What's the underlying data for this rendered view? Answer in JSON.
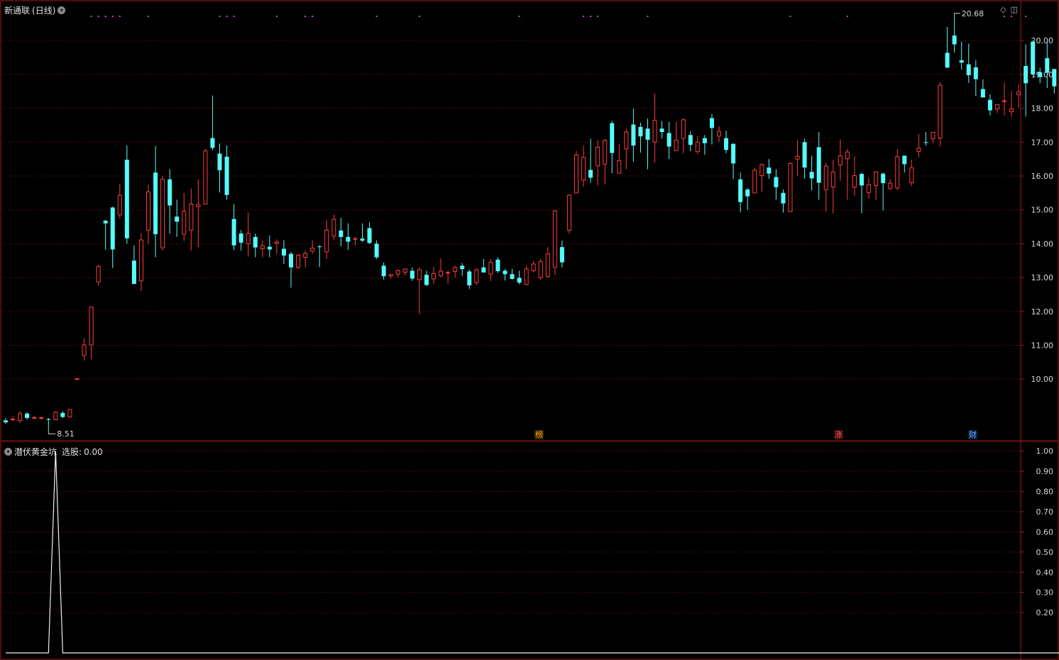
{
  "stock": {
    "name": "新通联",
    "period": "(日线)"
  },
  "indicator": {
    "name": "潜伏黄金坑",
    "label": "选股:",
    "value": "0.00"
  },
  "colors": {
    "up": "#ff3c3c",
    "down": "#54fcfc",
    "grid": "#7a1a1a",
    "frame": "#a01818",
    "signal": "#e040e0"
  },
  "price_axis": {
    "ticks": [
      "20.00",
      "19.00",
      "18.00",
      "17.00",
      "16.00",
      "15.00",
      "14.00",
      "13.00",
      "12.00",
      "11.00",
      "10.00"
    ]
  },
  "indicator_axis": {
    "ticks": [
      "1.00",
      "0.90",
      "0.80",
      "0.70",
      "0.60",
      "0.50",
      "0.40",
      "0.30",
      "0.20"
    ]
  },
  "annotations": {
    "high": "20.68",
    "low": "8.51"
  },
  "markers": [
    {
      "label": "榜",
      "color": "#e8a020"
    },
    {
      "label": "涨",
      "color": "#ff6060"
    },
    {
      "label": "财",
      "color": "#6aa8ff"
    }
  ],
  "chart_data": {
    "type": "candlestick",
    "ylim": [
      8.2,
      21.2
    ],
    "candles": [
      [
        8.78,
        8.72,
        8.85,
        8.68
      ],
      [
        8.8,
        8.82,
        8.9,
        8.75
      ],
      [
        8.78,
        8.98,
        9.05,
        8.7
      ],
      [
        8.98,
        8.85,
        9.02,
        8.8
      ],
      [
        8.85,
        8.86,
        8.92,
        8.82
      ],
      [
        8.84,
        8.86,
        8.9,
        8.8
      ],
      [
        8.82,
        8.8,
        8.85,
        8.51
      ],
      [
        8.8,
        9.02,
        9.05,
        8.78
      ],
      [
        9.0,
        8.88,
        9.05,
        8.85
      ],
      [
        8.88,
        9.1,
        9.12,
        8.86
      ],
      [
        10.01,
        10.01,
        10.02,
        10.0
      ],
      [
        10.7,
        11.01,
        11.2,
        10.55
      ],
      [
        11.01,
        12.13,
        12.14,
        10.58
      ],
      [
        12.87,
        13.33,
        13.37,
        12.76
      ],
      [
        14.68,
        14.6,
        14.7,
        13.82
      ],
      [
        15.07,
        13.83,
        15.09,
        13.28
      ],
      [
        14.85,
        15.43,
        15.76,
        14.75
      ],
      [
        16.48,
        14.16,
        16.9,
        14.0
      ],
      [
        13.5,
        12.81,
        13.95,
        12.8
      ],
      [
        12.9,
        14.11,
        14.31,
        12.6
      ],
      [
        14.4,
        15.53,
        15.74,
        14.0
      ],
      [
        16.1,
        14.28,
        16.89,
        13.6
      ],
      [
        13.88,
        15.9,
        16.0,
        13.8
      ],
      [
        15.9,
        15.13,
        16.2,
        14.3
      ],
      [
        14.8,
        14.65,
        15.3,
        14.2
      ],
      [
        14.28,
        14.96,
        15.5,
        14.08
      ],
      [
        14.4,
        15.17,
        15.63,
        13.8
      ],
      [
        15.1,
        15.16,
        15.9,
        13.9
      ],
      [
        15.17,
        16.74,
        16.8,
        15.3
      ],
      [
        17.12,
        16.83,
        18.38,
        16.76
      ],
      [
        16.66,
        16.17,
        16.96,
        15.51
      ],
      [
        16.57,
        15.44,
        16.9,
        15.3
      ],
      [
        14.73,
        13.95,
        15.17,
        13.81
      ],
      [
        14.3,
        14.03,
        14.4,
        13.8
      ],
      [
        14.0,
        14.3,
        14.92,
        13.62
      ],
      [
        14.2,
        13.89,
        14.3,
        13.6
      ],
      [
        13.85,
        13.94,
        14.1,
        13.6
      ],
      [
        13.91,
        13.83,
        14.24,
        13.6
      ],
      [
        14.01,
        14.05,
        14.13,
        13.7
      ],
      [
        13.85,
        13.65,
        14.1,
        13.4
      ],
      [
        13.7,
        13.3,
        13.75,
        12.7
      ],
      [
        13.3,
        13.66,
        13.7,
        13.25
      ],
      [
        13.6,
        13.71,
        13.8,
        13.3
      ],
      [
        13.78,
        13.87,
        14.1,
        13.7
      ],
      [
        13.92,
        13.9,
        13.96,
        13.31
      ],
      [
        13.76,
        14.4,
        14.7,
        13.55
      ],
      [
        14.23,
        14.72,
        14.86,
        14.1
      ],
      [
        14.39,
        14.2,
        14.76,
        13.92
      ],
      [
        14.2,
        14.06,
        14.6,
        13.82
      ],
      [
        14.14,
        14.15,
        14.2,
        13.94
      ],
      [
        14.15,
        14.09,
        14.6,
        14.05
      ],
      [
        14.46,
        14.02,
        14.63,
        13.99
      ],
      [
        14.0,
        13.6,
        14.1,
        13.55
      ],
      [
        13.35,
        13.04,
        13.45,
        12.94
      ],
      [
        13.05,
        13.09,
        13.1,
        12.97
      ],
      [
        13.1,
        13.2,
        13.24,
        13.0
      ],
      [
        13.16,
        13.25,
        13.27,
        13.05
      ],
      [
        13.2,
        12.97,
        13.3,
        12.9
      ],
      [
        12.94,
        13.23,
        13.3,
        11.92
      ],
      [
        13.08,
        12.78,
        13.2,
        12.75
      ],
      [
        12.96,
        13.12,
        13.32,
        12.8
      ],
      [
        13.05,
        13.19,
        13.57,
        13.01
      ],
      [
        13.15,
        13.15,
        13.2,
        12.82
      ],
      [
        13.18,
        13.3,
        13.35,
        13.0
      ],
      [
        13.35,
        13.25,
        13.43,
        13.05
      ],
      [
        13.18,
        12.77,
        13.24,
        12.66
      ],
      [
        12.85,
        13.23,
        13.28,
        12.78
      ],
      [
        13.3,
        13.15,
        13.55,
        13.2
      ],
      [
        13.1,
        13.45,
        13.54,
        12.9
      ],
      [
        13.53,
        13.19,
        13.6,
        13.14
      ],
      [
        13.2,
        13.1,
        13.25,
        12.91
      ],
      [
        13.1,
        12.96,
        13.26,
        12.94
      ],
      [
        12.99,
        12.85,
        13.2,
        12.8
      ],
      [
        12.8,
        13.25,
        13.35,
        12.77
      ],
      [
        13.2,
        13.4,
        13.5,
        13.15
      ],
      [
        13.0,
        13.47,
        13.56,
        12.93
      ],
      [
        13.03,
        13.7,
        13.9,
        13.0
      ],
      [
        13.3,
        14.97,
        15.0,
        13.07
      ],
      [
        13.9,
        13.45,
        14.1,
        13.3
      ],
      [
        14.4,
        15.43,
        15.47,
        14.3
      ],
      [
        15.5,
        16.62,
        16.74,
        15.8
      ],
      [
        15.88,
        16.55,
        16.9,
        15.69
      ],
      [
        16.18,
        15.95,
        17.1,
        15.8
      ],
      [
        16.3,
        16.85,
        17.05,
        15.72
      ],
      [
        16.35,
        17.05,
        17.09,
        15.75
      ],
      [
        17.56,
        16.68,
        17.63,
        16.08
      ],
      [
        16.08,
        16.45,
        16.95,
        16.1
      ],
      [
        16.8,
        17.3,
        17.4,
        16.2
      ],
      [
        17.52,
        16.9,
        17.99,
        16.42
      ],
      [
        17.45,
        17.17,
        17.58,
        16.69
      ],
      [
        17.4,
        17.07,
        17.7,
        16.2
      ],
      [
        17.0,
        17.64,
        18.43,
        16.4
      ],
      [
        17.4,
        17.3,
        17.63,
        17.1
      ],
      [
        17.27,
        16.87,
        17.6,
        16.5
      ],
      [
        16.75,
        17.06,
        17.6,
        16.8
      ],
      [
        17.11,
        17.66,
        17.71,
        16.67
      ],
      [
        17.21,
        16.92,
        17.32,
        16.73
      ],
      [
        16.72,
        17.0,
        17.19,
        16.65
      ],
      [
        17.12,
        16.97,
        17.21,
        16.63
      ],
      [
        17.71,
        17.42,
        17.83,
        16.93
      ],
      [
        17.18,
        17.32,
        17.47,
        17.01
      ],
      [
        17.12,
        16.77,
        17.34,
        16.67
      ],
      [
        16.95,
        16.37,
        16.97,
        15.91
      ],
      [
        15.9,
        15.23,
        16.1,
        14.93
      ],
      [
        15.6,
        15.4,
        15.65,
        15.0
      ],
      [
        15.5,
        16.17,
        16.24,
        15.6
      ],
      [
        16.01,
        16.33,
        16.38,
        15.54
      ],
      [
        16.25,
        16.07,
        16.5,
        15.92
      ],
      [
        15.97,
        15.67,
        16.2,
        15.3
      ],
      [
        15.5,
        15.19,
        15.6,
        14.92
      ],
      [
        14.95,
        16.37,
        16.4,
        14.95
      ],
      [
        16.5,
        16.58,
        17.06,
        16.0
      ],
      [
        17.0,
        16.25,
        17.1,
        15.92
      ],
      [
        16.12,
        15.93,
        16.6,
        15.57
      ],
      [
        16.85,
        15.8,
        17.3,
        15.3
      ],
      [
        15.6,
        16.29,
        16.4,
        14.95
      ],
      [
        15.68,
        16.12,
        16.48,
        14.9
      ],
      [
        16.33,
        16.6,
        17.08,
        15.86
      ],
      [
        16.51,
        16.71,
        16.8,
        15.3
      ],
      [
        15.67,
        16.01,
        16.58,
        15.4
      ],
      [
        16.06,
        15.72,
        16.1,
        14.9
      ],
      [
        15.51,
        15.74,
        15.94,
        15.33
      ],
      [
        15.72,
        16.12,
        16.14,
        15.29
      ],
      [
        16.07,
        15.79,
        16.1,
        14.98
      ],
      [
        15.63,
        15.79,
        15.91,
        15.6
      ],
      [
        15.65,
        16.57,
        16.8,
        15.58
      ],
      [
        16.6,
        16.35,
        16.6,
        16.1
      ],
      [
        15.8,
        16.24,
        16.49,
        15.7
      ],
      [
        16.73,
        16.82,
        17.24,
        16.55
      ],
      [
        17.0,
        16.99,
        17.3,
        16.9
      ],
      [
        17.1,
        17.29,
        17.3,
        16.97
      ],
      [
        17.12,
        18.68,
        18.78,
        16.87
      ],
      [
        19.64,
        19.2,
        20.4,
        19.45
      ],
      [
        20.15,
        19.89,
        20.68,
        19.65
      ],
      [
        19.42,
        19.35,
        19.97,
        19.15
      ],
      [
        19.3,
        18.98,
        19.91,
        18.75
      ],
      [
        19.21,
        18.86,
        19.42,
        18.36
      ],
      [
        18.57,
        18.32,
        18.86,
        18.33
      ],
      [
        18.25,
        17.94,
        18.41,
        17.79
      ],
      [
        17.98,
        18.11,
        18.12,
        17.87
      ],
      [
        18.2,
        18.22,
        18.76,
        17.79
      ],
      [
        17.9,
        17.98,
        18.51,
        17.76
      ],
      [
        18.41,
        18.48,
        18.71,
        18.02
      ],
      [
        19.25,
        18.74,
        19.89,
        17.76
      ],
      [
        19.97,
        19.0,
        20.0,
        18.98
      ],
      [
        19.07,
        18.93,
        19.2,
        18.74
      ],
      [
        19.48,
        19.05,
        19.97,
        18.6
      ],
      [
        19.16,
        18.65,
        19.17,
        18.44
      ],
      [
        18.67,
        18.02,
        18.74,
        17.82
      ],
      [
        17.8,
        18.01,
        18.29,
        17.39
      ],
      [
        17.94,
        18.27,
        18.46,
        18.05
      ],
      [
        18.9,
        18.14,
        18.91,
        17.92
      ],
      [
        17.77,
        17.69,
        18.2,
        17.0
      ],
      [
        17.76,
        17.78,
        18.0,
        17.69
      ],
      [
        17.59,
        17.8,
        18.01,
        17.69
      ],
      [
        17.76,
        17.97,
        18.2,
        17.76
      ],
      [
        17.91,
        18.25,
        18.8,
        17.92
      ],
      [
        18.56,
        18.7,
        19.05,
        17.94
      ],
      [
        18.71,
        18.83,
        18.86,
        18.59
      ]
    ],
    "indicator": {
      "ylim": [
        0,
        1.02
      ],
      "x_peak_index": 7,
      "values_note": "0 everywhere except 1.00 at bar 7"
    }
  }
}
